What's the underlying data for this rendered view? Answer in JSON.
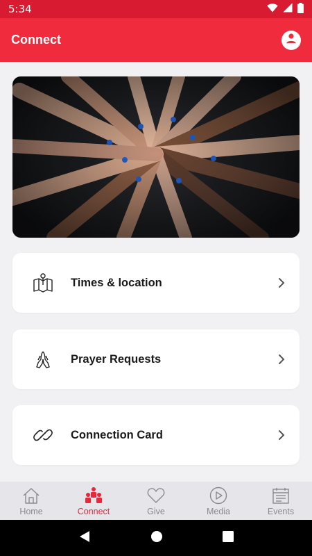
{
  "status_bar": {
    "time": "5:34",
    "icons": [
      "wifi-icon",
      "signal-icon",
      "battery-icon"
    ]
  },
  "app_bar": {
    "title": "Connect",
    "profile_icon": "user-icon"
  },
  "hero": {
    "alt": "Circle of joined hands wearing blue wristbands"
  },
  "cards": [
    {
      "label": "Times & location",
      "icon": "map-pin-icon"
    },
    {
      "label": "Prayer Requests",
      "icon": "praying-hands-icon"
    },
    {
      "label": "Connection Card",
      "icon": "link-icon"
    }
  ],
  "bottom_nav": {
    "active": "Connect",
    "items": [
      {
        "label": "Home",
        "icon": "home-icon"
      },
      {
        "label": "Connect",
        "icon": "people-icon"
      },
      {
        "label": "Give",
        "icon": "heart-icon"
      },
      {
        "label": "Media",
        "icon": "play-icon"
      },
      {
        "label": "Events",
        "icon": "calendar-icon"
      }
    ]
  },
  "colors": {
    "accent": "#ef2b3d",
    "status_bar": "#d81b31",
    "background": "#f1f1f3",
    "inactive": "#8a8a8e"
  }
}
